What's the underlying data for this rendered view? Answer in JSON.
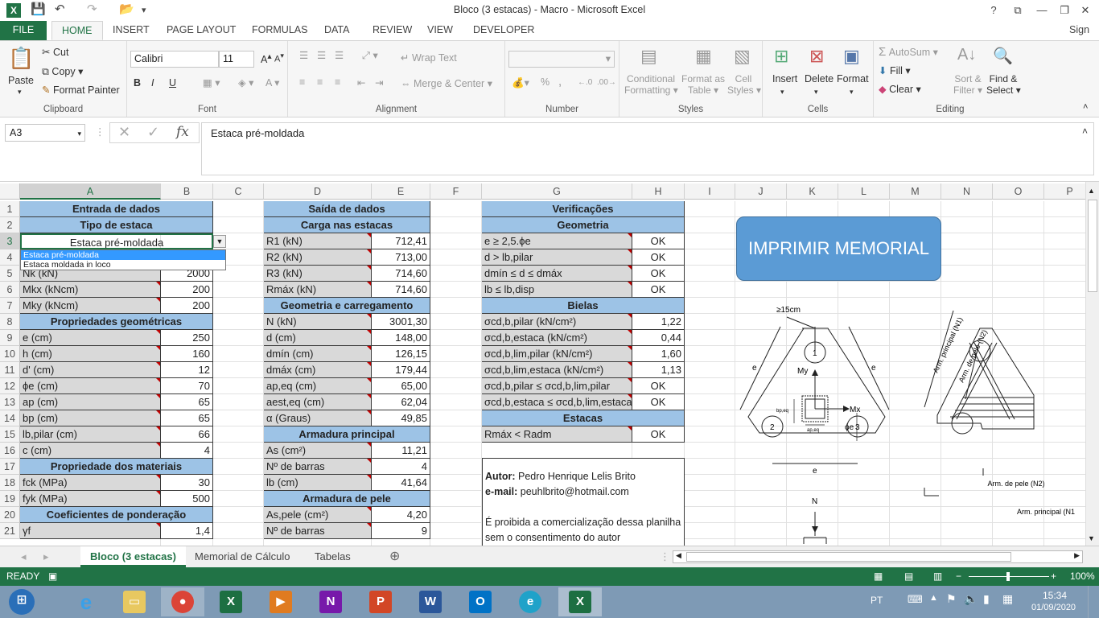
{
  "window": {
    "title": "Bloco (3 estacas) - Macro - Microsoft Excel",
    "help": "?",
    "restore": "⧉",
    "minimize": "—",
    "maximize": "❐",
    "close": "✕",
    "signin": "Sign in"
  },
  "tabs": [
    "FILE",
    "HOME",
    "INSERT",
    "PAGE LAYOUT",
    "FORMULAS",
    "DATA",
    "REVIEW",
    "VIEW",
    "DEVELOPER"
  ],
  "ribbon": {
    "clipboard": {
      "paste": "Paste",
      "cut": "Cut",
      "copy": "Copy",
      "format_painter": "Format Painter",
      "label": "Clipboard"
    },
    "font": {
      "name": "Calibri",
      "size": "11",
      "bold": "B",
      "italic": "I",
      "underline": "U",
      "label": "Font"
    },
    "alignment": {
      "wrap": "Wrap Text",
      "merge": "Merge & Center",
      "label": "Alignment"
    },
    "number": {
      "label": "Number",
      "percent": "%",
      "comma": ","
    },
    "styles": {
      "conditional": "Conditional",
      "conditional2": "Formatting",
      "format_table": "Format as",
      "format_table2": "Table",
      "cell_styles": "Cell",
      "cell_styles2": "Styles",
      "label": "Styles"
    },
    "cells": {
      "insert": "Insert",
      "delete": "Delete",
      "format": "Format",
      "label": "Cells"
    },
    "editing": {
      "autosum": "AutoSum",
      "fill": "Fill",
      "clear": "Clear",
      "sort": "Sort &",
      "sort2": "Filter",
      "find": "Find &",
      "find2": "Select",
      "label": "Editing"
    }
  },
  "formula_bar": {
    "name_box": "A3",
    "fx": "fx",
    "value": "Estaca pré-moldada"
  },
  "columns": [
    "A",
    "B",
    "C",
    "D",
    "E",
    "F",
    "G",
    "H",
    "I",
    "J",
    "K",
    "L",
    "M",
    "N",
    "O",
    "P"
  ],
  "rows": [
    "1",
    "2",
    "3",
    "4",
    "5",
    "6",
    "7",
    "8",
    "9",
    "10",
    "11",
    "12",
    "13",
    "14",
    "15",
    "16",
    "17",
    "18",
    "19",
    "20",
    "21"
  ],
  "entrada": {
    "title": "Entrada de dados",
    "tipo": "Tipo de estaca",
    "tipo_value": "Estaca pré-moldada",
    "r5": [
      "Nk (kN)",
      "2000"
    ],
    "r6": [
      "Mkx (kNcm)",
      "200"
    ],
    "r7": [
      "Mky (kNcm)",
      "200"
    ],
    "props": "Propriedades geométricas",
    "r9": [
      "e (cm)",
      "250"
    ],
    "r10": [
      "h (cm)",
      "160"
    ],
    "r11": [
      "d' (cm)",
      "12"
    ],
    "r12": [
      "ϕe (cm)",
      "70"
    ],
    "r13": [
      "ap (cm)",
      "65"
    ],
    "r14": [
      "bp (cm)",
      "65"
    ],
    "r15": [
      "lb,pilar (cm)",
      "66"
    ],
    "r16": [
      "c (cm)",
      "4"
    ],
    "mats": "Propriedade dos materiais",
    "r18": [
      "fck (MPa)",
      "30"
    ],
    "r19": [
      "fyk (MPa)",
      "500"
    ],
    "coef": "Coeficientes de ponderação",
    "r21": [
      "γf",
      "1,4"
    ]
  },
  "dropdown": [
    "Estaca pré-moldada",
    "Estaca moldada in loco"
  ],
  "saida": {
    "title": "Saída de dados",
    "carga": "Carga nas estacas",
    "r3": [
      "R1 (kN)",
      "712,41"
    ],
    "r4": [
      "R2 (kN)",
      "713,00"
    ],
    "r5": [
      "R3 (kN)",
      "714,60"
    ],
    "r6": [
      "Rmáx (kN)",
      "714,60"
    ],
    "geo": "Geometria e carregamento",
    "r8": [
      "N (kN)",
      "3001,30"
    ],
    "r9": [
      "d (cm)",
      "148,00"
    ],
    "r10": [
      "dmín (cm)",
      "126,15"
    ],
    "r11": [
      "dmáx (cm)",
      "179,44"
    ],
    "r12": [
      "ap,eq (cm)",
      "65,00"
    ],
    "r13": [
      "aest,eq (cm)",
      "62,04"
    ],
    "r14": [
      "α (Graus)",
      "49,85"
    ],
    "arm": "Armadura principal",
    "r16": [
      "As (cm²)",
      "11,21"
    ],
    "r17": [
      "Nº de barras",
      "4"
    ],
    "r18": [
      "lb (cm)",
      "41,64"
    ],
    "pele": "Armadura de pele",
    "r20": [
      "As,pele (cm²)",
      "4,20"
    ],
    "r21": [
      "Nº de barras",
      "9"
    ]
  },
  "verif": {
    "title": "Verificações",
    "geo": "Geometria",
    "r3": [
      "e ≥ 2,5.ϕe",
      "OK"
    ],
    "r4": [
      "d > lb,pilar",
      "OK"
    ],
    "r5": [
      "dmín ≤ d ≤ dmáx",
      "OK"
    ],
    "r6": [
      "lb ≤ lb,disp",
      "OK"
    ],
    "bielas": "Bielas",
    "r8": [
      "σcd,b,pilar (kN/cm²)",
      "1,22"
    ],
    "r9": [
      "σcd,b,estaca (kN/cm²)",
      "0,44"
    ],
    "r10": [
      "σcd,b,lim,pilar (kN/cm²)",
      "1,60"
    ],
    "r11": [
      "σcd,b,lim,estaca (kN/cm²)",
      "1,13"
    ],
    "r12": [
      "σcd,b,pilar ≤ σcd,b,lim,pilar",
      "OK"
    ],
    "r13": [
      "σcd,b,estaca ≤ σcd,b,lim,estaca",
      "OK"
    ],
    "estacas": "Estacas",
    "r15": [
      "Rmáx < Radm",
      "OK"
    ]
  },
  "autor": {
    "l1b": "Autor:",
    "l1": "Pedro Henrique Lelis Brito",
    "l2b": "e-mail:",
    "l2": "peuhlbrito@hotmail.com",
    "l3": "É proibida a comercialização dessa planilha",
    "l4": "sem o consentimento do autor"
  },
  "button": "IMPRIMIR MEMORIAL",
  "drawing": {
    "min": "≥15cm",
    "e": "e",
    "my": "My",
    "mx": "Mx",
    "pe": "ϕe",
    "p1": "1",
    "p2": "2",
    "p3": "3",
    "n": "N",
    "ap": "ap,eq",
    "bp": "bp,eq",
    "arm_princ": "Arm. principal (N1)",
    "arm_pele": "Arm. de pele (N2)",
    "arm_pele_b": "Arm. de pele (N2)",
    "arm_princ_b": "Arm. principal (N1"
  },
  "sheets": [
    "Bloco (3 estacas)",
    "Memorial de Cálculo",
    "Tabelas"
  ],
  "status": {
    "ready": "READY",
    "zoom": "100%"
  },
  "tray": {
    "lang": "PT",
    "time": "15:34",
    "date": "01/09/2020"
  },
  "colors": {
    "excel_green": "#217346",
    "header_blue": "#9dc3e6",
    "label_gray": "#d9d9d9",
    "button_blue": "#5b9bd5"
  }
}
